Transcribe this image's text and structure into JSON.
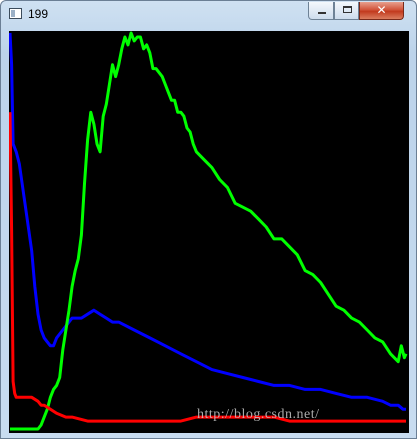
{
  "window": {
    "title": "199",
    "icon": "app-window-icon",
    "controls": {
      "minimize_icon": "minimize-icon",
      "maximize_icon": "maximize-icon",
      "close_icon": "close-icon",
      "close_glyph": "✕"
    }
  },
  "canvas": {
    "background": "#000000",
    "watermark": "http://blog.csdn.net/"
  },
  "chart_data": {
    "type": "line",
    "title": "",
    "xlabel": "",
    "ylabel": "",
    "xlim": [
      0,
      255
    ],
    "ylim": [
      0,
      100
    ],
    "grid": false,
    "legend": "none",
    "series": [
      {
        "color": "#0000ff",
        "x": [
          0,
          1,
          2,
          4,
          6,
          10,
          14,
          16,
          18,
          20,
          22,
          24,
          26,
          28,
          30,
          34,
          40,
          46,
          50,
          54,
          58,
          62,
          66,
          70,
          80,
          90,
          100,
          110,
          120,
          130,
          140,
          150,
          160,
          170,
          180,
          190,
          200,
          210,
          220,
          230,
          240,
          245,
          250,
          253,
          255
        ],
        "y": [
          100,
          92,
          72,
          70,
          67,
          56,
          45,
          36,
          29,
          25,
          23,
          22,
          21,
          21,
          23,
          25,
          28,
          28,
          29,
          30,
          29,
          28,
          27,
          27,
          25,
          23,
          21,
          19,
          17,
          15,
          14,
          13,
          12,
          11,
          11,
          10,
          10,
          9,
          8,
          8,
          7,
          6,
          6,
          5,
          5
        ]
      },
      {
        "color": "#00ff00",
        "x": [
          0,
          6,
          10,
          14,
          18,
          20,
          22,
          24,
          26,
          28,
          30,
          32,
          34,
          36,
          38,
          40,
          42,
          44,
          46,
          48,
          50,
          52,
          54,
          56,
          58,
          60,
          62,
          64,
          66,
          68,
          70,
          72,
          74,
          76,
          78,
          80,
          82,
          84,
          86,
          88,
          90,
          92,
          94,
          96,
          98,
          100,
          102,
          104,
          106,
          108,
          110,
          112,
          114,
          116,
          118,
          120,
          125,
          130,
          135,
          140,
          145,
          150,
          155,
          160,
          165,
          170,
          175,
          180,
          185,
          190,
          195,
          200,
          205,
          210,
          215,
          220,
          225,
          230,
          235,
          240,
          245,
          250,
          252,
          254,
          255
        ],
        "y": [
          0,
          0,
          0,
          0,
          0,
          1,
          3,
          5,
          8,
          10,
          11,
          13,
          20,
          25,
          30,
          36,
          40,
          43,
          49,
          62,
          73,
          80,
          77,
          72,
          70,
          79,
          82,
          87,
          92,
          89,
          92,
          96,
          99,
          97,
          100,
          98,
          99,
          99,
          96,
          97,
          95,
          91,
          91,
          90,
          89,
          87,
          85,
          83,
          83,
          80,
          80,
          79,
          76,
          75,
          72,
          70,
          68,
          66,
          63,
          61,
          57,
          56,
          55,
          53,
          51,
          48,
          48,
          46,
          44,
          40,
          39,
          37,
          34,
          31,
          30,
          28,
          27,
          25,
          23,
          22,
          19,
          17,
          21,
          18,
          19
        ]
      },
      {
        "color": "#ff0000",
        "x": [
          0,
          1,
          2,
          3,
          4,
          6,
          10,
          14,
          18,
          20,
          22,
          26,
          30,
          36,
          40,
          50,
          60,
          70,
          80,
          90,
          100,
          110,
          120,
          130,
          140,
          150,
          160,
          170,
          180,
          190,
          200,
          210,
          220,
          230,
          240,
          250,
          255
        ],
        "y": [
          80,
          50,
          12,
          9,
          8,
          8,
          8,
          8,
          7,
          6,
          6,
          5,
          4,
          3,
          3,
          2,
          2,
          2,
          2,
          2,
          2,
          2,
          3,
          3,
          3,
          3,
          3,
          3,
          2,
          2,
          2,
          2,
          2,
          2,
          2,
          2,
          2
        ]
      }
    ]
  }
}
